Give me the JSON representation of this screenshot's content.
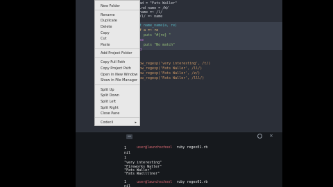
{
  "editor": {
    "code_lines": [
      "ad = \"Fats Waller\"",
      ".nd name = /W/",
      "name =~ /l/",
      "/l/ =~ name",
      "",
      "t name_name(a, re)",
      "f a =~ re",
      "  puts \"#{re} \"",
      "se",
      "  puts \"No match\"",
      "d",
      "",
      "",
      "",
      "ow_regexp('very interesting', /t/)",
      "ow_regexp('Fats Waller', /ll/)",
      "ow_regexp('Fats Waller', /z/)",
      "ow_regexp('Fats Waller', /lll/)"
    ]
  },
  "context_menu": {
    "items": [
      "New Folder",
      "Rename",
      "Duplicate",
      "Delete",
      "Copy",
      "Cut",
      "Paste",
      "Add Project Folder",
      "Copy Full Path",
      "Copy Project Path",
      "Open in New Window",
      "Show in File Manager",
      "Split Up",
      "Split Down",
      "Split Left",
      "Split Right",
      "Close Pane",
      "Codecli"
    ],
    "submenu_arrow": "▸"
  },
  "terminal": {
    "icons": [
      "terminal-icon",
      "gear-icon",
      "close-icon"
    ],
    "close_glyph": "×",
    "lines": [
      {
        "user": "user@launchschool",
        "cmd": "  ruby regex01.rb"
      },
      {
        "text": "1"
      },
      {
        "text": "nil"
      },
      {
        "text": "1"
      },
      {
        "text": "\"very interesting\""
      },
      {
        "text": "\"Fireworks Waller\""
      },
      {
        "text": "\"Fats Waller\""
      },
      {
        "text": "\"Fats Waxllllner\""
      },
      {
        "user": "user@launchschool",
        "cmd": "  ruby regex01.rb"
      },
      {
        "text": "1"
      },
      {
        "text": "nil"
      },
      {
        "text": "1"
      }
    ]
  }
}
